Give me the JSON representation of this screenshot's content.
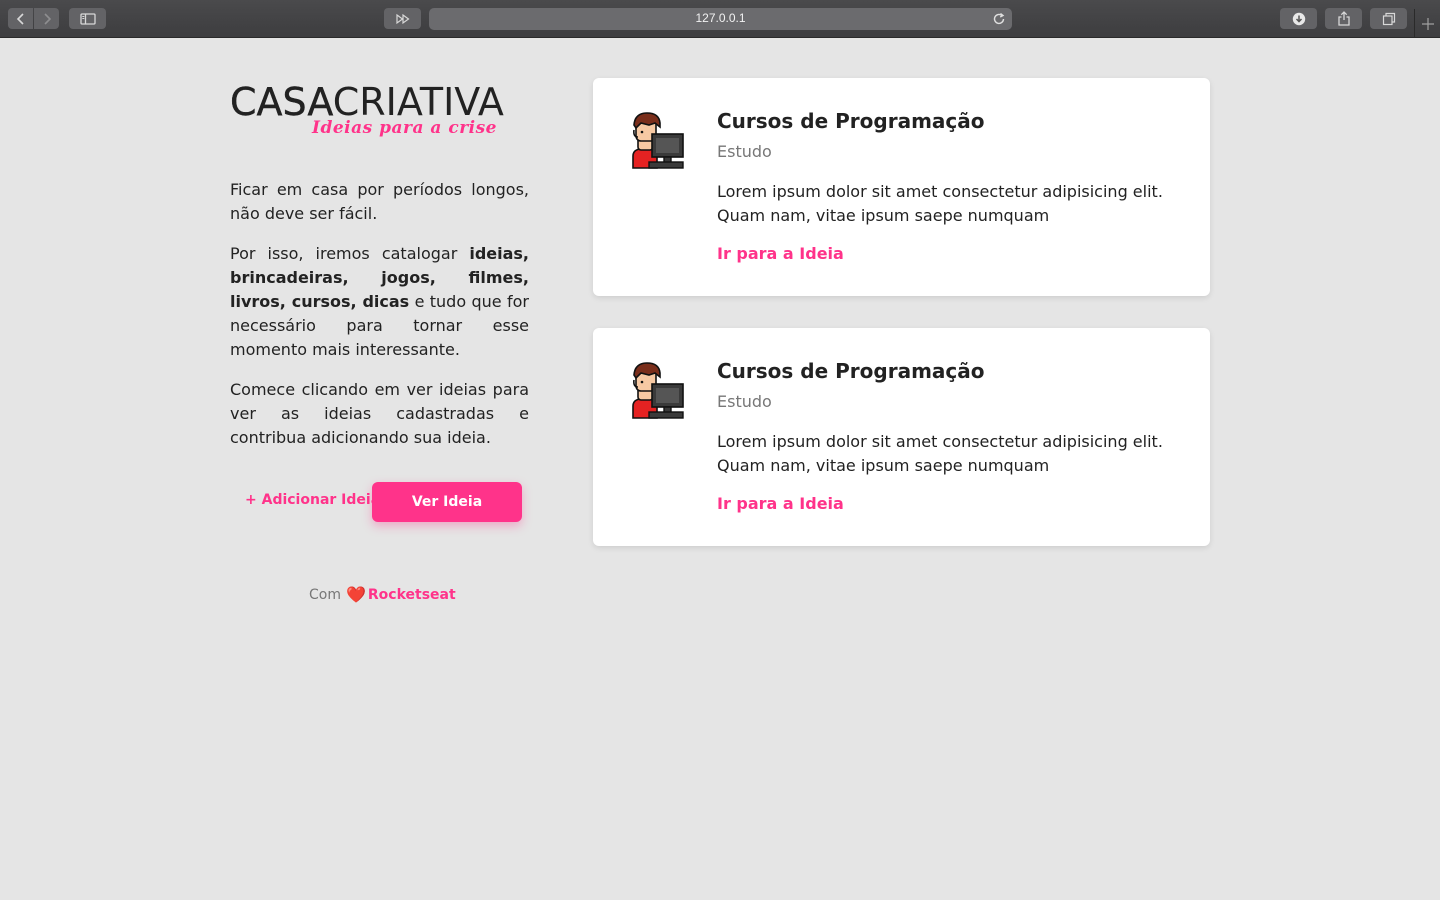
{
  "browser": {
    "url": "127.0.0.1"
  },
  "logo": {
    "casa": "CASA",
    "criativa": "CRIATIVA",
    "tagline": "Ideias para a crise"
  },
  "intro": {
    "p1": "Ficar em casa por períodos longos, não deve ser fácil.",
    "p2_start": "Por isso, iremos catalogar ",
    "p2_bold": "ideias, brincadeiras, jogos, filmes, livros, cursos, dicas",
    "p2_end": " e tudo que for necessário para tornar esse momento mais interessante.",
    "p3": "Comece clicando em ver ideias para ver as ideias cadastradas e contribua adicionando sua ideia."
  },
  "actions": {
    "add_label": "+ Adicionar Ideia",
    "view_label": "Ver Ideia"
  },
  "footer": {
    "prefix": "Com",
    "heart": "❤️",
    "brand": "Rocketseat"
  },
  "ideas": [
    {
      "title": "Cursos de Programação",
      "category": "Estudo",
      "description": "Lorem ipsum dolor sit amet consectetur adipisicing elit. Quam nam, vitae ipsum saepe numquam",
      "link_label": "Ir para a Ideia",
      "icon": "programmer-icon"
    },
    {
      "title": "Cursos de Programação",
      "category": "Estudo",
      "description": "Lorem ipsum dolor sit amet consectetur adipisicing elit. Quam nam, vitae ipsum saepe numquam",
      "link_label": "Ir para a Ideia",
      "icon": "programmer-icon"
    }
  ],
  "colors": {
    "accent": "#ff338a",
    "background": "#e5e5e5",
    "card": "#ffffff",
    "text": "#222222",
    "muted": "#777777"
  }
}
